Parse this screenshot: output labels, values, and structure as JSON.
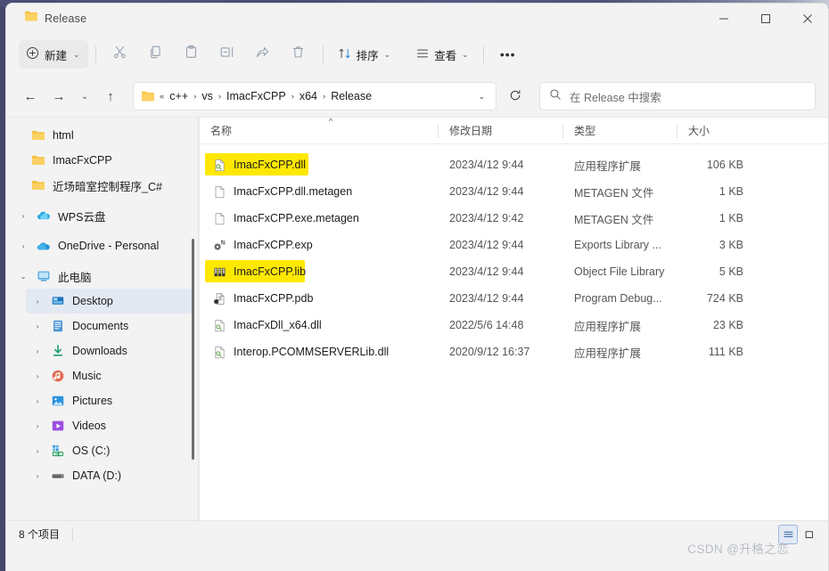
{
  "window": {
    "title": "Release",
    "controls": {
      "minimize": "—",
      "maximize": "☐",
      "close": "✕"
    }
  },
  "toolbar": {
    "new_label": "新建",
    "cut_label": "cut-icon",
    "copy_label": "copy-icon",
    "paste_label": "paste-icon",
    "rename_label": "rename-icon",
    "share_label": "share-icon",
    "delete_label": "delete-icon",
    "sort_label": "排序",
    "view_label": "查看",
    "more_label": "•••",
    "chevron": "⌄"
  },
  "address": {
    "back": "←",
    "forward": "→",
    "recent": "⌄",
    "up": "↑",
    "overflow": "«",
    "crumbs": [
      "c++",
      "vs",
      "ImacFxCPP",
      "x64",
      "Release"
    ],
    "separator": "›",
    "dropdown": "⌄",
    "refresh": "⟳"
  },
  "search": {
    "icon": "search-icon",
    "placeholder": "在 Release 中搜索"
  },
  "sidebar": {
    "items": [
      {
        "label": "html",
        "icon": "folder",
        "expander": "",
        "indent": true,
        "selected": false
      },
      {
        "label": "ImacFxCPP",
        "icon": "folder",
        "expander": "",
        "indent": true,
        "selected": false
      },
      {
        "label": "近场暗室控制程序_C#",
        "icon": "folder",
        "expander": "",
        "indent": true,
        "selected": false
      },
      {
        "label": "WPS云盘",
        "icon": "wps-cloud",
        "expander": "›",
        "indent": false,
        "selected": false
      },
      {
        "label": "OneDrive - Personal",
        "icon": "onedrive",
        "expander": "›",
        "indent": false,
        "selected": false
      },
      {
        "label": "此电脑",
        "icon": "this-pc",
        "expander": "⌄",
        "indent": false,
        "selected": false
      },
      {
        "label": "Desktop",
        "icon": "desktop",
        "expander": "›",
        "indent": true,
        "selected": true
      },
      {
        "label": "Documents",
        "icon": "documents",
        "expander": "›",
        "indent": true,
        "selected": false
      },
      {
        "label": "Downloads",
        "icon": "downloads",
        "expander": "›",
        "indent": true,
        "selected": false
      },
      {
        "label": "Music",
        "icon": "music",
        "expander": "›",
        "indent": true,
        "selected": false
      },
      {
        "label": "Pictures",
        "icon": "pictures",
        "expander": "›",
        "indent": true,
        "selected": false
      },
      {
        "label": "Videos",
        "icon": "videos",
        "expander": "›",
        "indent": true,
        "selected": false
      },
      {
        "label": "OS (C:)",
        "icon": "os-drive",
        "expander": "›",
        "indent": true,
        "selected": false
      },
      {
        "label": "DATA (D:)",
        "icon": "drive",
        "expander": "›",
        "indent": true,
        "selected": false
      }
    ]
  },
  "filelist": {
    "columns": {
      "name": "名称",
      "date": "修改日期",
      "type": "类型",
      "size": "大小"
    },
    "sort_caret": "^",
    "rows": [
      {
        "name": "ImacFxCPP.dll",
        "date": "2023/4/12 9:44",
        "type": "应用程序扩展",
        "size": "106 KB",
        "icon": "dll",
        "highlight": true
      },
      {
        "name": "ImacFxCPP.dll.metagen",
        "date": "2023/4/12 9:44",
        "type": "METAGEN 文件",
        "size": "1 KB",
        "icon": "blank",
        "highlight": false
      },
      {
        "name": "ImacFxCPP.exe.metagen",
        "date": "2023/4/12 9:42",
        "type": "METAGEN 文件",
        "size": "1 KB",
        "icon": "blank",
        "highlight": false
      },
      {
        "name": "ImacFxCPP.exp",
        "date": "2023/4/12 9:44",
        "type": "Exports Library ...",
        "size": "3 KB",
        "icon": "exp",
        "highlight": false
      },
      {
        "name": "ImacFxCPP.lib",
        "date": "2023/4/12 9:44",
        "type": "Object File Library",
        "size": "5 KB",
        "icon": "lib",
        "highlight": true
      },
      {
        "name": "ImacFxCPP.pdb",
        "date": "2023/4/12 9:44",
        "type": "Program Debug...",
        "size": "724 KB",
        "icon": "pdb",
        "highlight": false
      },
      {
        "name": "ImacFxDll_x64.dll",
        "date": "2022/5/6 14:48",
        "type": "应用程序扩展",
        "size": "23 KB",
        "icon": "dll",
        "highlight": false
      },
      {
        "name": "Interop.PCOMMSERVERLib.dll",
        "date": "2020/9/12 16:37",
        "type": "应用程序扩展",
        "size": "111 KB",
        "icon": "dll",
        "highlight": false
      }
    ]
  },
  "statusbar": {
    "count": "8 个项目",
    "view_details": "details-view-icon",
    "view_large": "large-icons-view-icon"
  },
  "watermark": "CSDN @升格之恋",
  "colors": {
    "accent": "#0078d4",
    "highlight_marker": "#ffe800",
    "window_bg": "#f3f3f3",
    "list_bg": "#ffffff",
    "selected_nav": "#e3e9f2"
  }
}
